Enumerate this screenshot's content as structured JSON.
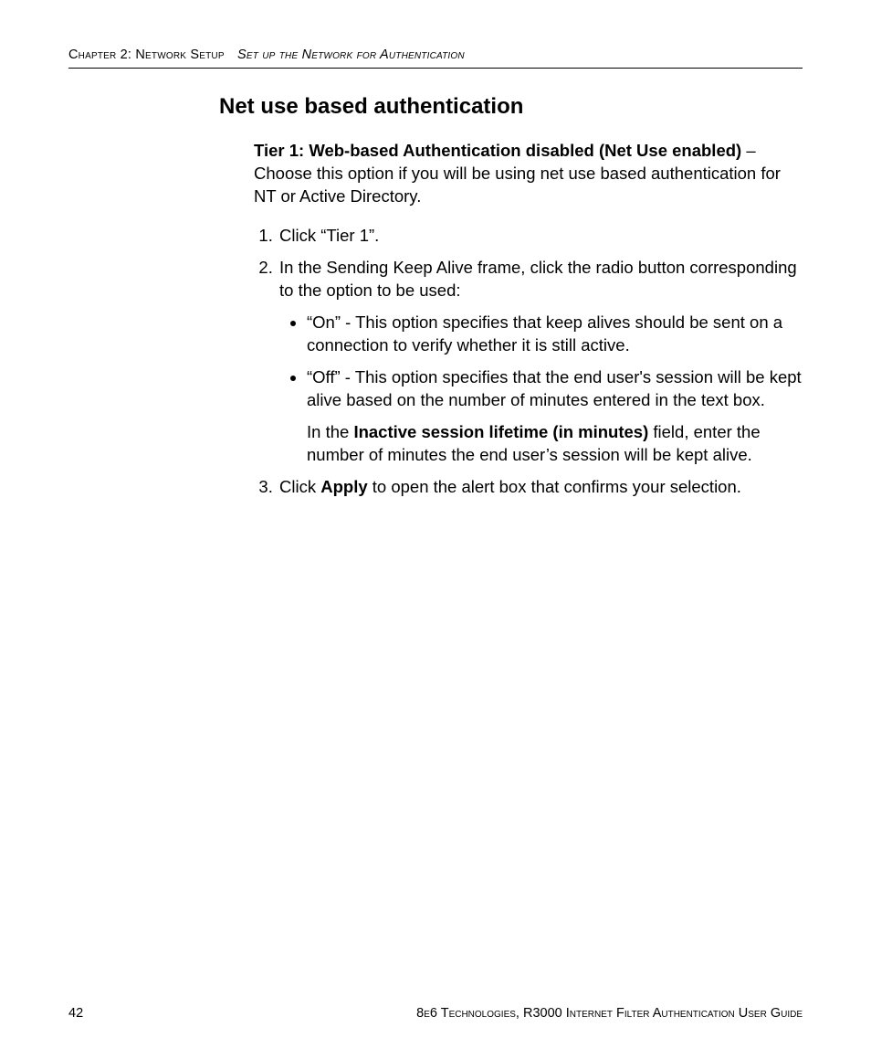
{
  "header": {
    "chapter_label": "Chapter 2: Network Setup",
    "section_label": "Set up the Network for Authentication"
  },
  "heading": "Net use based authentication",
  "intro": {
    "bold_lead": "Tier 1: Web-based Authentication disabled (Net Use enabled)",
    "rest": " – Choose this option if you will be using net use based authentication for NT or Active Directory."
  },
  "steps": {
    "one": "Click “Tier 1”.",
    "two_intro": "In the Sending Keep Alive frame, click the radio button corresponding to the option to be used:",
    "two_bullets": {
      "on": "“On” - This option specifies that keep alives should be sent on a connection to verify whether it is still active.",
      "off": "“Off” - This option specifies that the end user's session will be kept alive based on the number of minutes entered in the text box.",
      "off_note_pre": "In the ",
      "off_note_bold": "Inactive session lifetime (in minutes)",
      "off_note_post": " field, enter the number of minutes the end user’s session will be kept alive."
    },
    "three_pre": "Click ",
    "three_bold": "Apply",
    "three_post": " to open the alert box that confirms your selection."
  },
  "footer": {
    "page_number": "42",
    "right": "8e6 Technologies, R3000 Internet Filter Authentication User Guide"
  }
}
